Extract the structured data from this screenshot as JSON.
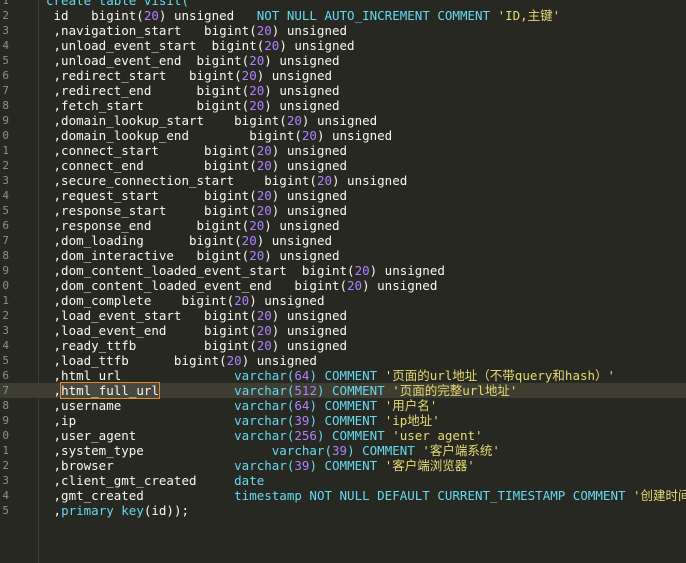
{
  "colors": {
    "background": "#272822",
    "foreground": "#f8f8f2",
    "keyword": "#66d9ef",
    "number": "#ae81ff",
    "string": "#e6db74",
    "line_number": "#8f908a",
    "selection_outline": "#e08a2b"
  },
  "lines": [
    {
      "n": "1",
      "tokens": [
        {
          "t": "create table visit(",
          "c": "kw"
        }
      ]
    },
    {
      "n": "2",
      "tokens": [
        {
          "t": " id   bigint(",
          "c": ""
        },
        {
          "t": "20",
          "c": "num"
        },
        {
          "t": ") unsigned   ",
          "c": ""
        },
        {
          "t": "NOT NULL AUTO_INCREMENT COMMENT ",
          "c": "kw"
        },
        {
          "t": "'ID,主键'",
          "c": "str"
        }
      ]
    },
    {
      "n": "3",
      "tokens": [
        {
          "t": " ,navigation_start   bigint(",
          "c": ""
        },
        {
          "t": "20",
          "c": "num"
        },
        {
          "t": ") unsigned",
          "c": ""
        }
      ]
    },
    {
      "n": "4",
      "tokens": [
        {
          "t": " ,unload_event_start  bigint(",
          "c": ""
        },
        {
          "t": "20",
          "c": "num"
        },
        {
          "t": ") unsigned",
          "c": ""
        }
      ]
    },
    {
      "n": "5",
      "tokens": [
        {
          "t": " ,unload_event_end  bigint(",
          "c": ""
        },
        {
          "t": "20",
          "c": "num"
        },
        {
          "t": ") unsigned",
          "c": ""
        }
      ]
    },
    {
      "n": "6",
      "tokens": [
        {
          "t": " ,redirect_start   bigint(",
          "c": ""
        },
        {
          "t": "20",
          "c": "num"
        },
        {
          "t": ") unsigned",
          "c": ""
        }
      ]
    },
    {
      "n": "7",
      "tokens": [
        {
          "t": " ,redirect_end      bigint(",
          "c": ""
        },
        {
          "t": "20",
          "c": "num"
        },
        {
          "t": ") unsigned",
          "c": ""
        }
      ]
    },
    {
      "n": "8",
      "tokens": [
        {
          "t": " ,fetch_start       bigint(",
          "c": ""
        },
        {
          "t": "20",
          "c": "num"
        },
        {
          "t": ") unsigned",
          "c": ""
        }
      ]
    },
    {
      "n": "9",
      "tokens": [
        {
          "t": " ,domain_lookup_start    bigint(",
          "c": ""
        },
        {
          "t": "20",
          "c": "num"
        },
        {
          "t": ") unsigned",
          "c": ""
        }
      ]
    },
    {
      "n": "0",
      "tokens": [
        {
          "t": " ,domain_lookup_end        bigint(",
          "c": ""
        },
        {
          "t": "20",
          "c": "num"
        },
        {
          "t": ") unsigned",
          "c": ""
        }
      ]
    },
    {
      "n": "1",
      "tokens": [
        {
          "t": " ,connect_start      bigint(",
          "c": ""
        },
        {
          "t": "20",
          "c": "num"
        },
        {
          "t": ") unsigned",
          "c": ""
        }
      ]
    },
    {
      "n": "2",
      "tokens": [
        {
          "t": " ,connect_end        bigint(",
          "c": ""
        },
        {
          "t": "20",
          "c": "num"
        },
        {
          "t": ") unsigned",
          "c": ""
        }
      ]
    },
    {
      "n": "3",
      "tokens": [
        {
          "t": " ,secure_connection_start    bigint(",
          "c": ""
        },
        {
          "t": "20",
          "c": "num"
        },
        {
          "t": ") unsigned",
          "c": ""
        }
      ]
    },
    {
      "n": "4",
      "tokens": [
        {
          "t": " ,request_start      bigint(",
          "c": ""
        },
        {
          "t": "20",
          "c": "num"
        },
        {
          "t": ") unsigned",
          "c": ""
        }
      ]
    },
    {
      "n": "5",
      "tokens": [
        {
          "t": " ,response_start     bigint(",
          "c": ""
        },
        {
          "t": "20",
          "c": "num"
        },
        {
          "t": ") unsigned",
          "c": ""
        }
      ]
    },
    {
      "n": "6",
      "tokens": [
        {
          "t": " ,response_end      bigint(",
          "c": ""
        },
        {
          "t": "20",
          "c": "num"
        },
        {
          "t": ") unsigned",
          "c": ""
        }
      ]
    },
    {
      "n": "7",
      "tokens": [
        {
          "t": " ,dom_loading      bigint(",
          "c": ""
        },
        {
          "t": "20",
          "c": "num"
        },
        {
          "t": ") unsigned",
          "c": ""
        }
      ]
    },
    {
      "n": "8",
      "tokens": [
        {
          "t": " ,dom_interactive   bigint(",
          "c": ""
        },
        {
          "t": "20",
          "c": "num"
        },
        {
          "t": ") unsigned",
          "c": ""
        }
      ]
    },
    {
      "n": "9",
      "tokens": [
        {
          "t": " ,dom_content_loaded_event_start  bigint(",
          "c": ""
        },
        {
          "t": "20",
          "c": "num"
        },
        {
          "t": ") unsigned",
          "c": ""
        }
      ]
    },
    {
      "n": "0",
      "tokens": [
        {
          "t": " ,dom_content_loaded_event_end   bigint(",
          "c": ""
        },
        {
          "t": "20",
          "c": "num"
        },
        {
          "t": ") unsigned",
          "c": ""
        }
      ]
    },
    {
      "n": "1",
      "tokens": [
        {
          "t": " ,dom_complete    bigint(",
          "c": ""
        },
        {
          "t": "20",
          "c": "num"
        },
        {
          "t": ") unsigned",
          "c": ""
        }
      ]
    },
    {
      "n": "2",
      "tokens": [
        {
          "t": " ,load_event_start   bigint(",
          "c": ""
        },
        {
          "t": "20",
          "c": "num"
        },
        {
          "t": ") unsigned",
          "c": ""
        }
      ]
    },
    {
      "n": "3",
      "tokens": [
        {
          "t": " ,load_event_end     bigint(",
          "c": ""
        },
        {
          "t": "20",
          "c": "num"
        },
        {
          "t": ") unsigned",
          "c": ""
        }
      ]
    },
    {
      "n": "4",
      "tokens": [
        {
          "t": " ,ready_ttfb         bigint(",
          "c": ""
        },
        {
          "t": "20",
          "c": "num"
        },
        {
          "t": ") unsigned",
          "c": ""
        }
      ]
    },
    {
      "n": "5",
      "tokens": [
        {
          "t": " ,load_ttfb      bigint(",
          "c": ""
        },
        {
          "t": "20",
          "c": "num"
        },
        {
          "t": ") unsigned",
          "c": ""
        }
      ]
    },
    {
      "n": "6",
      "tokens": [
        {
          "t": " ,html_url               ",
          "c": ""
        },
        {
          "t": "varchar(",
          "c": "kw"
        },
        {
          "t": "64",
          "c": "num"
        },
        {
          "t": ") COMMENT ",
          "c": "kw"
        },
        {
          "t": "'页面的url地址（不带query和hash）'",
          "c": "str"
        }
      ]
    },
    {
      "n": "7",
      "hl": true,
      "tokens": [
        {
          "t": " ,",
          "c": ""
        },
        {
          "t": "html_full_url",
          "c": "sel"
        },
        {
          "t": "          ",
          "c": ""
        },
        {
          "t": "varchar(",
          "c": "kw"
        },
        {
          "t": "512",
          "c": "num"
        },
        {
          "t": ") COMMENT ",
          "c": "kw"
        },
        {
          "t": "'页面的完整url地址'",
          "c": "str"
        }
      ]
    },
    {
      "n": "8",
      "tokens": [
        {
          "t": " ,username               ",
          "c": ""
        },
        {
          "t": "varchar(",
          "c": "kw"
        },
        {
          "t": "64",
          "c": "num"
        },
        {
          "t": ") COMMENT ",
          "c": "kw"
        },
        {
          "t": "'用户名'",
          "c": "str"
        }
      ]
    },
    {
      "n": "9",
      "tokens": [
        {
          "t": " ,ip                     ",
          "c": ""
        },
        {
          "t": "varchar(",
          "c": "kw"
        },
        {
          "t": "39",
          "c": "num"
        },
        {
          "t": ") COMMENT ",
          "c": "kw"
        },
        {
          "t": "'ip地址'",
          "c": "str"
        }
      ]
    },
    {
      "n": "0",
      "tokens": [
        {
          "t": " ,user_agent             ",
          "c": ""
        },
        {
          "t": "varchar(",
          "c": "kw"
        },
        {
          "t": "256",
          "c": "num"
        },
        {
          "t": ") COMMENT ",
          "c": "kw"
        },
        {
          "t": "'user agent'",
          "c": "str"
        }
      ]
    },
    {
      "n": "1",
      "tokens": [
        {
          "t": " ,system_type                 ",
          "c": ""
        },
        {
          "t": "varchar(",
          "c": "kw"
        },
        {
          "t": "39",
          "c": "num"
        },
        {
          "t": ") COMMENT ",
          "c": "kw"
        },
        {
          "t": "'客户端系统'",
          "c": "str"
        }
      ]
    },
    {
      "n": "2",
      "tokens": [
        {
          "t": " ,browser                ",
          "c": ""
        },
        {
          "t": "varchar(",
          "c": "kw"
        },
        {
          "t": "39",
          "c": "num"
        },
        {
          "t": ") COMMENT ",
          "c": "kw"
        },
        {
          "t": "'客户端浏览器'",
          "c": "str"
        }
      ]
    },
    {
      "n": "3",
      "tokens": [
        {
          "t": " ,client_gmt_created     ",
          "c": ""
        },
        {
          "t": "date",
          "c": "kw"
        }
      ]
    },
    {
      "n": "4",
      "tokens": [
        {
          "t": " ,gmt_created            ",
          "c": ""
        },
        {
          "t": "timestamp NOT NULL DEFAULT CURRENT_TIMESTAMP COMMENT ",
          "c": "kw"
        },
        {
          "t": "'创建时间'",
          "c": "str"
        }
      ]
    },
    {
      "n": "5",
      "tokens": [
        {
          "t": " ,",
          "c": ""
        },
        {
          "t": "primary key",
          "c": "kw"
        },
        {
          "t": "(id));",
          "c": ""
        }
      ]
    }
  ]
}
